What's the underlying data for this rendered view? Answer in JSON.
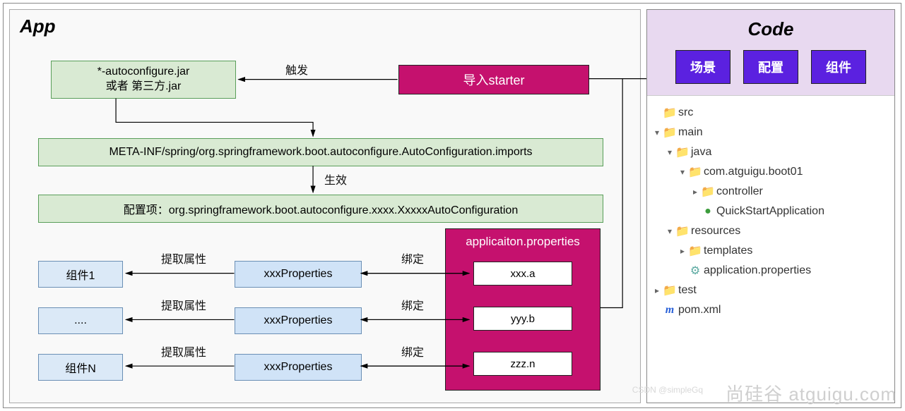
{
  "app": {
    "title": "App",
    "starter_box": "导入starter",
    "autoconfig_jar_line1": "*-autoconfigure.jar",
    "autoconfig_jar_line2": "或者  第三方.jar",
    "meta_inf": "META-INF/spring/org.springframework.boot.autoconfigure.AutoConfiguration.imports",
    "config_item": "配置项：org.springframework.boot.autoconfigure.xxxx.XxxxxAutoConfiguration",
    "labels": {
      "trigger": "触发",
      "effect": "生效",
      "bind": "绑定",
      "extract": "提取属性"
    },
    "components": [
      "组件1",
      "....",
      "组件N"
    ],
    "properties": [
      "xxxProperties",
      "xxxProperties",
      "xxxProperties"
    ],
    "app_props": {
      "title": "applicaiton.properties",
      "entries": [
        "xxx.a",
        "yyy.b",
        "zzz.n"
      ]
    }
  },
  "code": {
    "title": "Code",
    "buttons": [
      "场景",
      "配置",
      "组件"
    ],
    "tree": {
      "src": "src",
      "main": "main",
      "java": "java",
      "pkg": "com.atguigu.boot01",
      "controller": "controller",
      "app_class": "QuickStartApplication",
      "resources": "resources",
      "templates": "templates",
      "app_props": "application.properties",
      "test": "test",
      "pom": "pom.xml"
    }
  },
  "watermarks": {
    "brand": "尚硅谷 atguigu.com",
    "csdn": "CSDN @simpleGq"
  }
}
